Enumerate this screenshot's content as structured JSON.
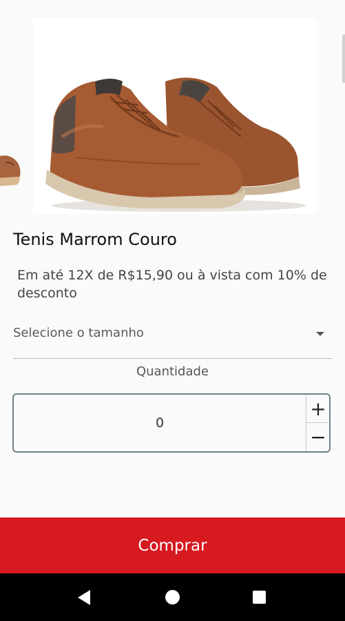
{
  "product": {
    "title": "Tenis Marrom Couro",
    "price_text": "Em até 12X de R$15,90 ou à vista com 10% de desconto",
    "image_icon": "brown-leather-sneakers-image"
  },
  "size_select": {
    "placeholder": "Selecione o tamanho",
    "icon": "dropdown-caret-icon"
  },
  "quantity": {
    "label": "Quantidade",
    "value": "0",
    "plus": "+",
    "minus": "−"
  },
  "buy_button": {
    "label": "Comprar",
    "color": "#d71920"
  },
  "nav_bar": {
    "icons": [
      "back-icon",
      "home-icon",
      "recents-icon"
    ]
  }
}
